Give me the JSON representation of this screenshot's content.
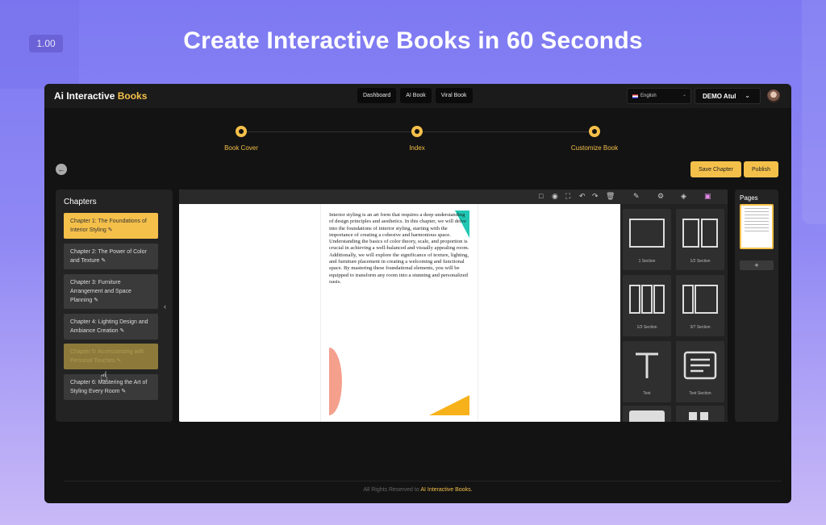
{
  "zoom_level": "1.00",
  "hero_title": "Create Interactive Books in 60 Seconds",
  "app": {
    "brand_prefix": "Ai Interactive",
    "brand_accent": "Books",
    "nav": [
      "Dashboard",
      "AI Book",
      "Viral Book"
    ],
    "language": "English",
    "user_name": "DEMO Atul"
  },
  "steps": [
    "Book Cover",
    "Index",
    "Customize Book"
  ],
  "actions": {
    "save": "Save Chapter",
    "publish": "Publish"
  },
  "chapters": {
    "title": "Chapters",
    "items": [
      "Chapter 1: The Foundations of Interior Styling",
      "Chapter 2: The Power of Color and Texture",
      "Chapter 3: Furniture Arrangement and Space Planning",
      "Chapter 4: Lighting Design and Ambiance Creation",
      "Chapter 5: Accessorizing with Personal Touches",
      "Chapter 6: Mastering the Art of Styling Every Room"
    ]
  },
  "book_text": "Interior styling is an art form that requires a deep understanding of design principles and aesthetics. In this chapter, we will delve into the foundations of interior styling, starting with the importance of creating a cohesive and harmonious space. Understanding the basics of color theory, scale, and proportion is crucial in achieving a well-balanced and visually appealing room. Additionally, we will explore the significance of texture, lighting, and furniture placement in creating a welcoming and functional space. By mastering these foundational elements, you will be equipped to transform any room into a stunning and personalized oasis.",
  "palette": [
    "1 Section",
    "1/2 Section",
    "1/3 Section",
    "3/7 Section",
    "Text",
    "Text Section"
  ],
  "pages": {
    "title": "Pages",
    "add": "+"
  },
  "footer": {
    "prefix": "All Rights Reserved to",
    "brand": "AI Interactive Books."
  },
  "colors": {
    "accent": "#f5c04a",
    "teal": "#1fc7b4",
    "salmon": "#f4a08d",
    "orange": "#f7b21b"
  }
}
